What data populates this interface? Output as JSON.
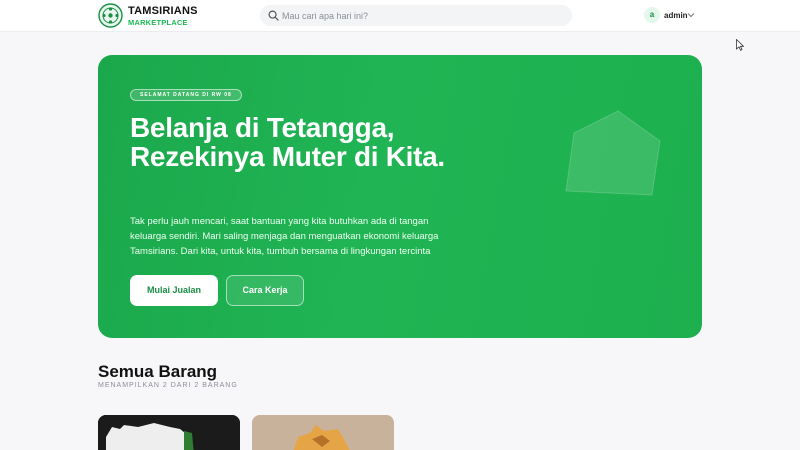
{
  "header": {
    "brand_title": "TAMSIRIANS",
    "brand_subtitle": "MARKETPLACE",
    "search_placeholder": "Mau cari apa hari ini?",
    "user": {
      "avatar_initial": "a",
      "name": "admin"
    }
  },
  "hero": {
    "badge": "SELAMAT DATANG DI RW 08",
    "title": "Belanja di Tetangga, Rezekinya Muter di Kita.",
    "description": "Tak perlu jauh mencari, saat bantuan yang kita butuhkan ada di tangan keluarga sendiri. Mari saling menjaga dan menguatkan ekonomi keluarga Tamsirians. Dari kita, untuk kita, tumbuh bersama di lingkungan tercinta",
    "primary_button": "Mulai Jualan",
    "secondary_button": "Cara Kerja"
  },
  "section": {
    "title": "Semua Barang",
    "subtitle": "MENAMPILKAN 2 DARI 2 BARANG"
  },
  "colors": {
    "brand_green": "#1db954",
    "hero_green": "#20b454",
    "text_dark": "#111111",
    "muted": "#8a8f98"
  },
  "icons": [
    "logo-icon",
    "search-icon",
    "chevron-down-icon",
    "cursor-icon"
  ]
}
